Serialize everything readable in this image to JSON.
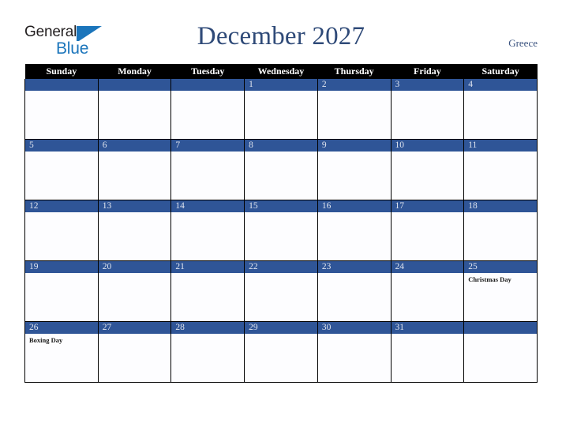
{
  "brand": {
    "name_top": "General",
    "name_bottom": "Blue",
    "triangle_icon": "triangle-icon",
    "color_dark": "#231f20",
    "color_blue": "#1b75bb"
  },
  "header": {
    "title": "December 2027",
    "region": "Greece",
    "title_color": "#2f4a78"
  },
  "calendar": {
    "month": "December",
    "year": "2027",
    "weekday_headers": [
      "Sunday",
      "Monday",
      "Tuesday",
      "Wednesday",
      "Thursday",
      "Friday",
      "Saturday"
    ],
    "header_bg": "#000000",
    "header_fg": "#ffffff",
    "date_band_bg": "#2f5597",
    "date_band_fg": "#dfe4ee",
    "cell_bg": "#fdfdff",
    "grid_line": "#000000",
    "weeks": [
      [
        {
          "date": "",
          "holiday": ""
        },
        {
          "date": "",
          "holiday": ""
        },
        {
          "date": "",
          "holiday": ""
        },
        {
          "date": "1",
          "holiday": ""
        },
        {
          "date": "2",
          "holiday": ""
        },
        {
          "date": "3",
          "holiday": ""
        },
        {
          "date": "4",
          "holiday": ""
        }
      ],
      [
        {
          "date": "5",
          "holiday": ""
        },
        {
          "date": "6",
          "holiday": ""
        },
        {
          "date": "7",
          "holiday": ""
        },
        {
          "date": "8",
          "holiday": ""
        },
        {
          "date": "9",
          "holiday": ""
        },
        {
          "date": "10",
          "holiday": ""
        },
        {
          "date": "11",
          "holiday": ""
        }
      ],
      [
        {
          "date": "12",
          "holiday": ""
        },
        {
          "date": "13",
          "holiday": ""
        },
        {
          "date": "14",
          "holiday": ""
        },
        {
          "date": "15",
          "holiday": ""
        },
        {
          "date": "16",
          "holiday": ""
        },
        {
          "date": "17",
          "holiday": ""
        },
        {
          "date": "18",
          "holiday": ""
        }
      ],
      [
        {
          "date": "19",
          "holiday": ""
        },
        {
          "date": "20",
          "holiday": ""
        },
        {
          "date": "21",
          "holiday": ""
        },
        {
          "date": "22",
          "holiday": ""
        },
        {
          "date": "23",
          "holiday": ""
        },
        {
          "date": "24",
          "holiday": ""
        },
        {
          "date": "25",
          "holiday": "Christmas Day"
        }
      ],
      [
        {
          "date": "26",
          "holiday": "Boxing Day"
        },
        {
          "date": "27",
          "holiday": ""
        },
        {
          "date": "28",
          "holiday": ""
        },
        {
          "date": "29",
          "holiday": ""
        },
        {
          "date": "30",
          "holiday": ""
        },
        {
          "date": "31",
          "holiday": ""
        },
        {
          "date": "",
          "holiday": ""
        }
      ]
    ]
  }
}
